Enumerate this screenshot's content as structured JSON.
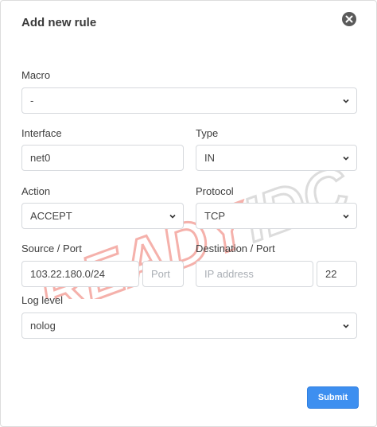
{
  "dialog": {
    "title": "Add new rule"
  },
  "form": {
    "macro": {
      "label": "Macro",
      "value": "-"
    },
    "interface": {
      "label": "Interface",
      "value": "net0"
    },
    "type": {
      "label": "Type",
      "value": "IN"
    },
    "action": {
      "label": "Action",
      "value": "ACCEPT"
    },
    "protocol": {
      "label": "Protocol",
      "value": "TCP"
    },
    "source": {
      "label": "Source / Port",
      "value": "103.22.180.0/24",
      "port_placeholder": "Port"
    },
    "destination": {
      "label": "Destination / Port",
      "ip_placeholder": "IP address",
      "port_value": "22"
    },
    "log_level": {
      "label": "Log level",
      "value": "nolog"
    }
  },
  "submit_label": "Submit",
  "watermark_text": "READYIDC",
  "colors": {
    "accent": "#3d8ff0",
    "watermark": "#f3a6a0",
    "watermark_gray": "#d9d9d9"
  }
}
